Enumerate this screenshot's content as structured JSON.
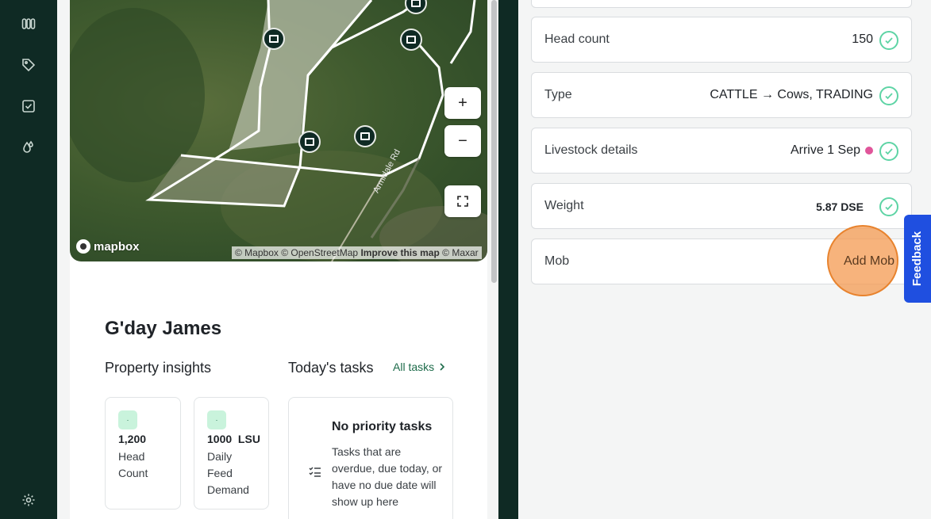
{
  "sidebar": {
    "icons": [
      "herd-icon",
      "tag-icon",
      "task-check-icon",
      "drops-icon",
      "settings-icon"
    ]
  },
  "map": {
    "logo_text": "mapbox",
    "attribution": "© Mapbox © OpenStreetMap",
    "improve_link": "Improve this map",
    "attribution_maxar": "© Maxar",
    "road_label": "Armidale Rd",
    "zoom_in": "+",
    "zoom_out": "−",
    "fullscreen_icon": "expand-icon"
  },
  "dashboard": {
    "greeting": "G'day James",
    "property_insights_title": "Property insights",
    "todays_tasks_title": "Today's tasks",
    "all_tasks_link": "All tasks",
    "insights": [
      {
        "value": "1,200",
        "label": "Head Count"
      },
      {
        "value": "1000  LSU",
        "label": "Daily Feed Demand"
      }
    ],
    "tasks": {
      "empty_title": "No priority tasks",
      "empty_desc": "Tasks that are overdue, due today, or have no due date will show up here"
    }
  },
  "form": {
    "fields": [
      {
        "label": "Head count",
        "value": "150"
      },
      {
        "label": "Type",
        "value": "CATTLE → Cows, TRADING"
      },
      {
        "label": "Livestock details",
        "value": "Arrive 1 Sep"
      },
      {
        "label": "Weight",
        "value": "5.87 DSE"
      },
      {
        "label": "Mob",
        "value": "Add Mob"
      }
    ],
    "accent_color": "#5ed4a5",
    "status_dot_color": "#e0559a"
  },
  "feedback_tab": "Feedback"
}
